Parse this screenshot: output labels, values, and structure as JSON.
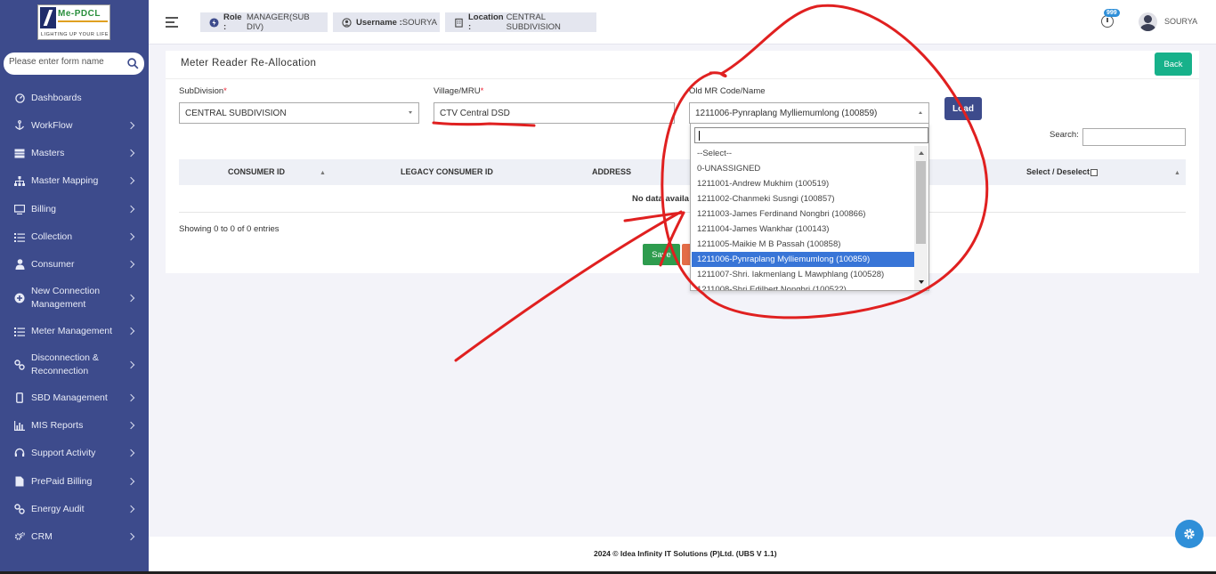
{
  "brand": {
    "logo_name": "Me-PDCL",
    "tagline": "LIGHTING UP YOUR LIFE"
  },
  "sidebar": {
    "search_placeholder": "Please enter form name",
    "items": [
      {
        "label": "Dashboards",
        "icon": "dashboard-icon",
        "has_children": false
      },
      {
        "label": "WorkFlow",
        "icon": "anchor-icon",
        "has_children": true
      },
      {
        "label": "Masters",
        "icon": "table-icon",
        "has_children": true
      },
      {
        "label": "Master Mapping",
        "icon": "sitemap-icon",
        "has_children": true
      },
      {
        "label": "Billing",
        "icon": "monitor-icon",
        "has_children": true
      },
      {
        "label": "Collection",
        "icon": "list-icon",
        "has_children": true
      },
      {
        "label": "Consumer",
        "icon": "user-icon",
        "has_children": true
      },
      {
        "label": "New Connection Management",
        "icon": "plus-circle-icon",
        "has_children": true
      },
      {
        "label": "Meter Management",
        "icon": "list-icon",
        "has_children": true
      },
      {
        "label": "Disconnection & Reconnection",
        "icon": "link-icon",
        "has_children": true
      },
      {
        "label": "SBD Management",
        "icon": "mobile-icon",
        "has_children": true
      },
      {
        "label": "MIS Reports",
        "icon": "bar-chart-icon",
        "has_children": true
      },
      {
        "label": "Support Activity",
        "icon": "headset-icon",
        "has_children": true
      },
      {
        "label": "PrePaid Billing",
        "icon": "file-icon",
        "has_children": true
      },
      {
        "label": "Energy Audit",
        "icon": "link-icon",
        "has_children": true
      },
      {
        "label": "CRM",
        "icon": "cogs-icon",
        "has_children": true
      }
    ]
  },
  "topbar": {
    "role_label": "Role :",
    "role_value": "MANAGER(SUB DIV)",
    "username_label": "Username :",
    "username_value": "SOURYA",
    "location_label": "Location :",
    "location_value": "CENTRAL SUBDIVISION",
    "notification_count": "999",
    "user_name": "SOURYA"
  },
  "page": {
    "title": "Meter Reader Re-Allocation",
    "back_label": "Back",
    "fields": {
      "subdivision": {
        "label": "SubDivision",
        "value": "CENTRAL SUBDIVISION"
      },
      "village": {
        "label": "Village/MRU",
        "value": "CTV Central DSD"
      },
      "old_mr": {
        "label": "Old MR Code/Name",
        "value": "1211006-Pynraplang Mylliemumlong (100859)"
      }
    },
    "required_mark": "*",
    "load_label": "Load",
    "search_label": "Search:",
    "table": {
      "columns": [
        "CONSUMER ID",
        "LEGACY CONSUMER ID",
        "ADDRESS",
        "Select / Deselect"
      ],
      "empty_text": "No data availa",
      "info": "Showing 0 to 0 of 0 entries"
    },
    "save_label": "Save"
  },
  "dropdown": {
    "search_value": "",
    "options": [
      "--Select--",
      "0-UNASSIGNED",
      "1211001-Andrew Mukhim (100519)",
      "1211002-Chanmeki Susngi (100857)",
      "1211003-James Ferdinand Nongbri (100866)",
      "1211004-James Wankhar (100143)",
      "1211005-Maikie M B Passah (100858)",
      "1211006-Pynraplang Mylliemumlong (100859)",
      "1211007-Shri. Iakmenlang L Mawphlang (100528)",
      "1211008-Shri Edilbert Nongbri (100522)"
    ],
    "selected_index": 7
  },
  "footer": {
    "text": "2024 © Idea Infinity IT Solutions (P)Ltd. (UBS V 1.1)"
  },
  "colors": {
    "sidebar": "#3d4b8c",
    "accent_green": "#17b18a",
    "selected_blue": "#3875d7",
    "annotation_red": "#e02020"
  }
}
